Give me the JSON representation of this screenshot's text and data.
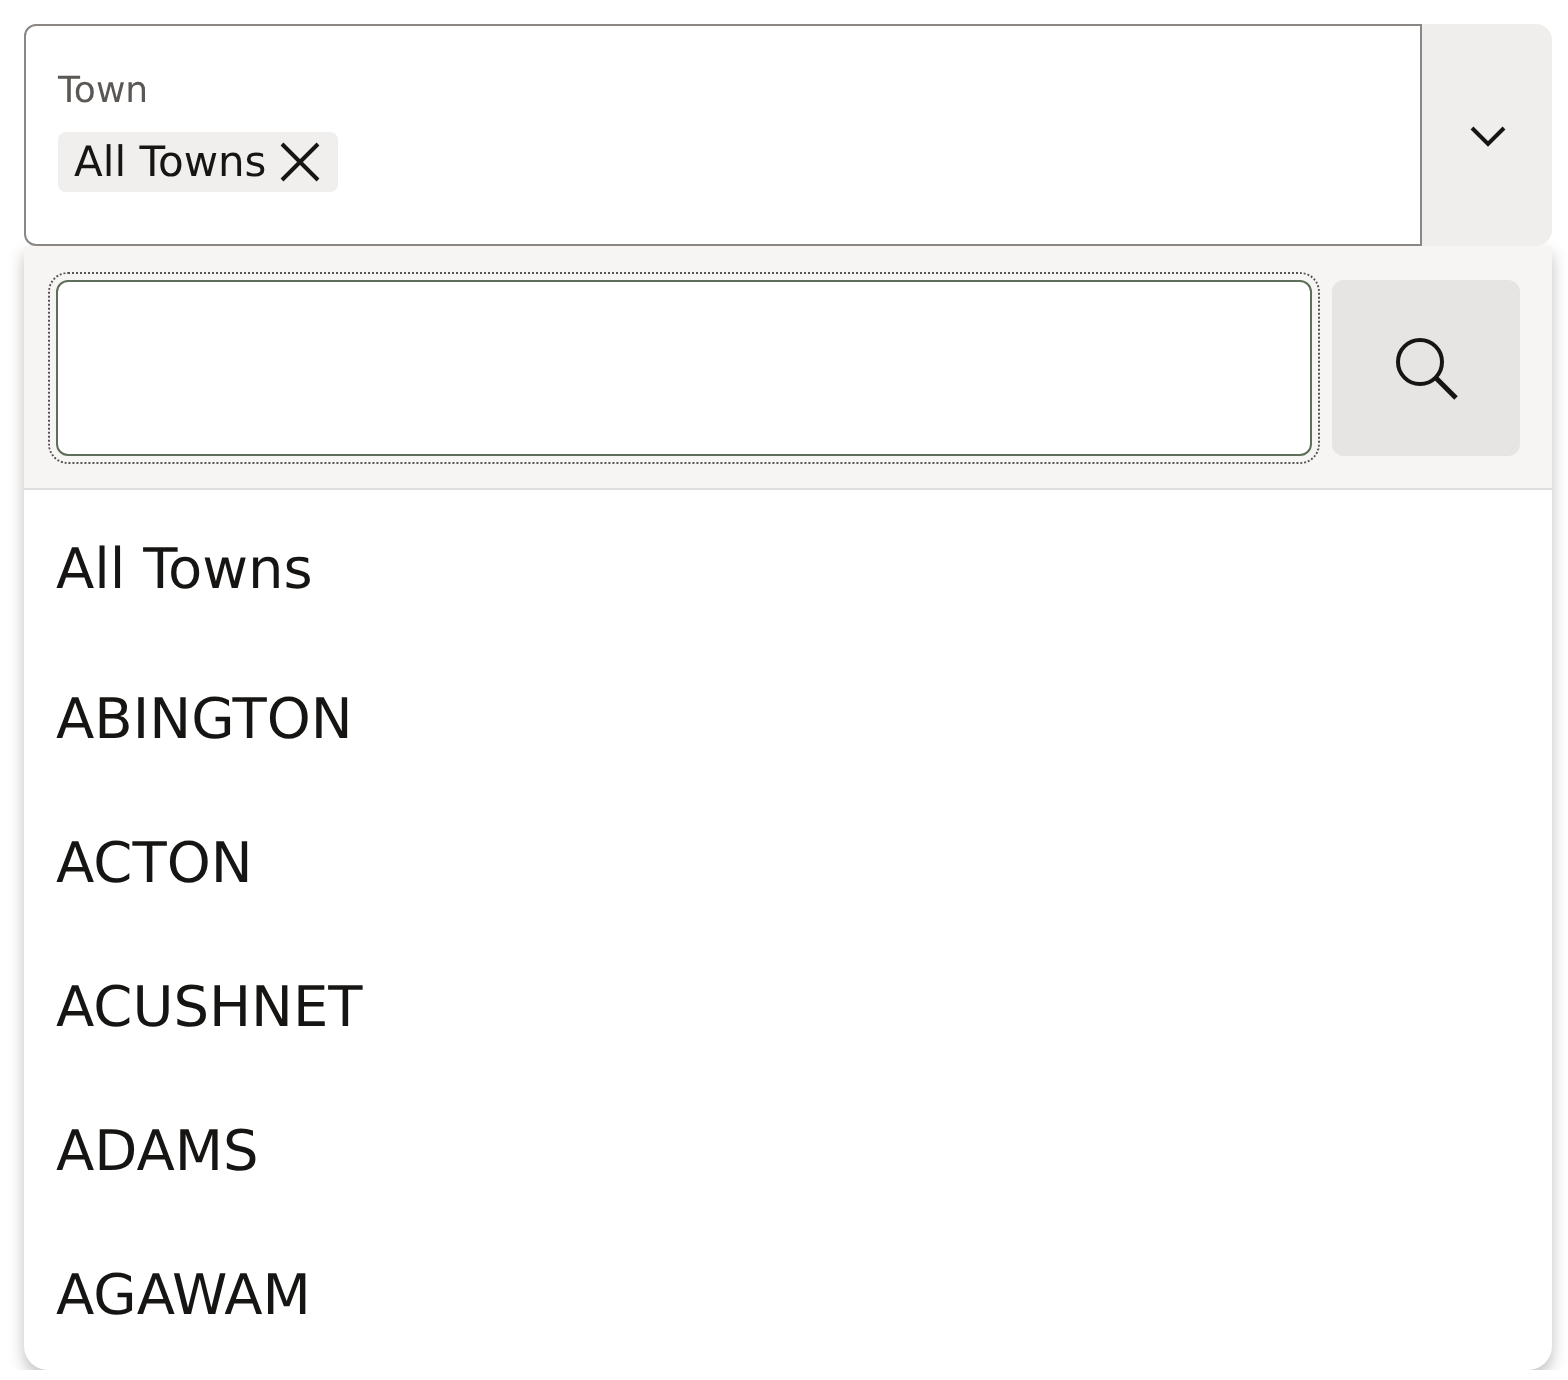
{
  "field": {
    "label": "Town",
    "chips": [
      {
        "text": "All Towns"
      }
    ]
  },
  "options": [
    {
      "label": "All Towns"
    },
    {
      "label": "ABINGTON"
    },
    {
      "label": "ACTON"
    },
    {
      "label": "ACUSHNET"
    },
    {
      "label": "ADAMS"
    },
    {
      "label": "AGAWAM"
    }
  ]
}
